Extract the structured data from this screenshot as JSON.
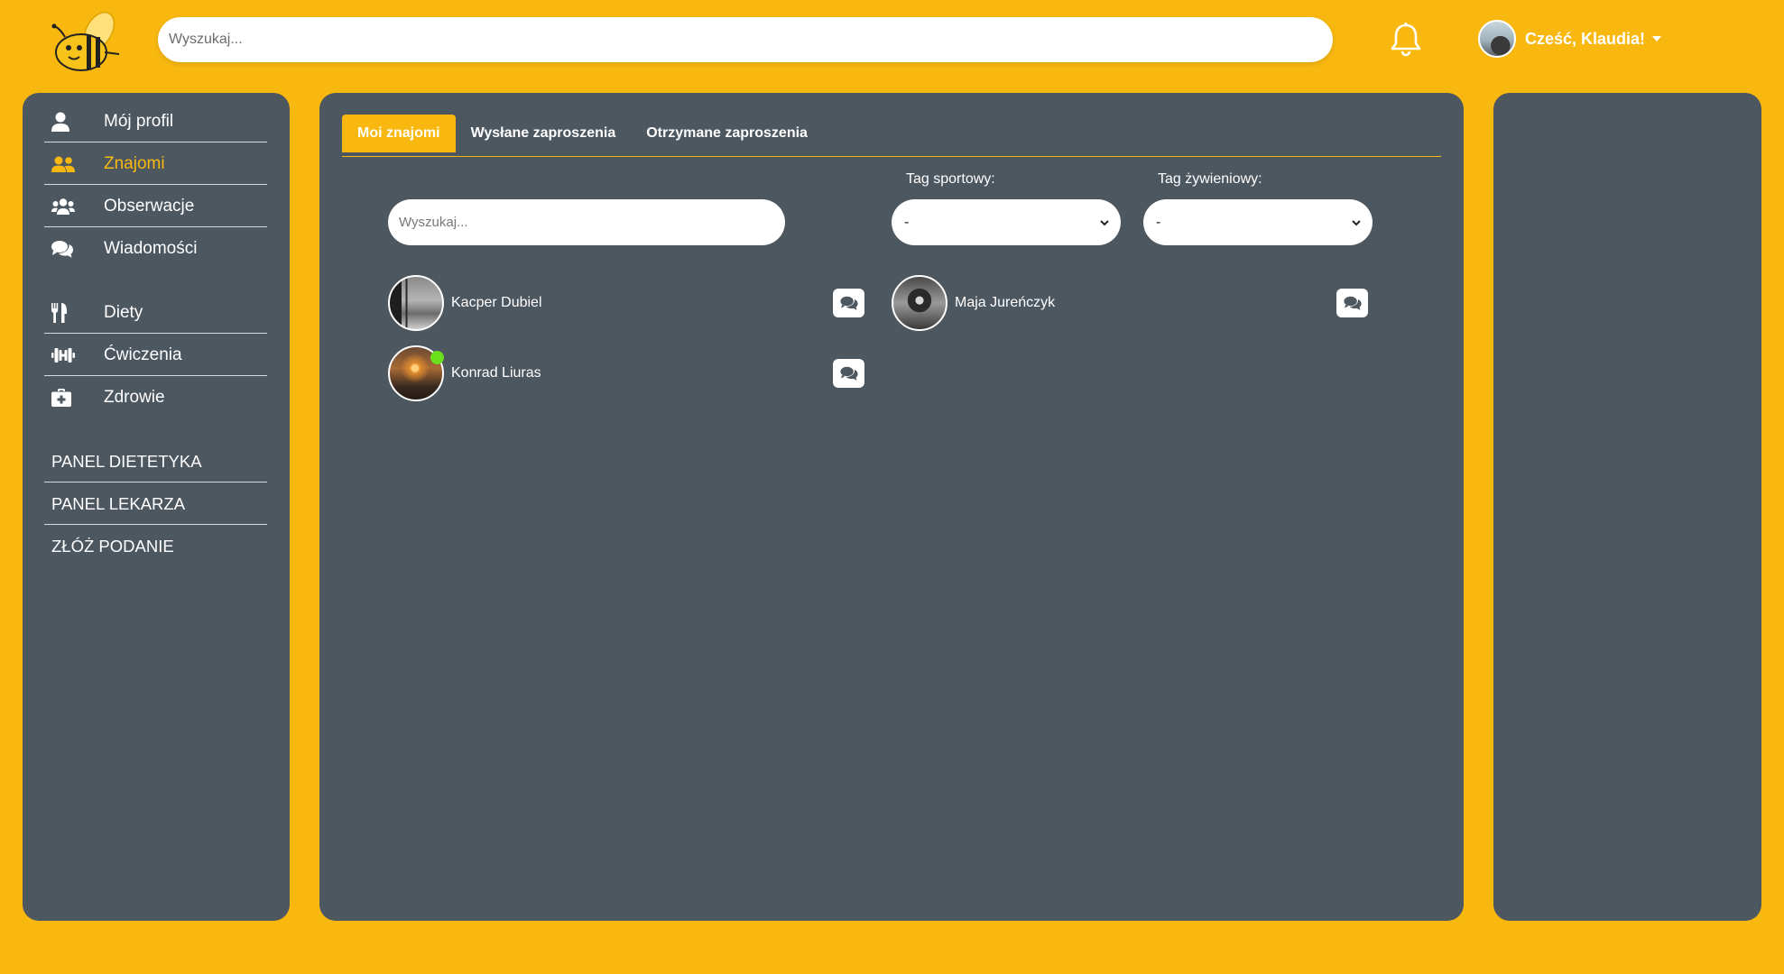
{
  "header": {
    "search_placeholder": "Wyszukaj...",
    "greeting": "Cześć, Klaudia!",
    "logo_icon": "bee-logo-icon",
    "notification_icon": "bell-icon"
  },
  "sidebar": {
    "items": [
      {
        "label": "Mój profil",
        "icon": "user-icon"
      },
      {
        "label": "Znajomi",
        "icon": "user-friends-icon",
        "active": true
      },
      {
        "label": "Obserwacje",
        "icon": "users-icon"
      },
      {
        "label": "Wiadomości",
        "icon": "comments-icon"
      },
      {
        "label": "Diety",
        "icon": "utensils-icon"
      },
      {
        "label": "Ćwiczenia",
        "icon": "dumbbell-icon"
      },
      {
        "label": "Zdrowie",
        "icon": "medkit-icon"
      }
    ],
    "panels": [
      {
        "label": "PANEL DIETETYKA"
      },
      {
        "label": "PANEL LEKARZA"
      },
      {
        "label": "ZŁÓŻ PODANIE"
      }
    ]
  },
  "main": {
    "tabs": [
      {
        "label": "Moi znajomi",
        "active": true
      },
      {
        "label": "Wysłane zaproszenia"
      },
      {
        "label": "Otrzymane zaproszenia"
      }
    ],
    "search_placeholder": "Wyszukaj...",
    "sport_tag": {
      "label": "Tag sportowy:",
      "value": "-"
    },
    "diet_tag": {
      "label": "Tag żywieniowy:",
      "value": "-"
    },
    "friends": [
      {
        "name": "Kacper Dubiel",
        "online": false
      },
      {
        "name": "Maja Jureńczyk",
        "online": false
      },
      {
        "name": "Konrad Liuras",
        "online": true
      }
    ]
  },
  "colors": {
    "background": "#F8B810",
    "panel": "#4D5760",
    "accent": "#F8B810",
    "online": "#6BE01D"
  }
}
